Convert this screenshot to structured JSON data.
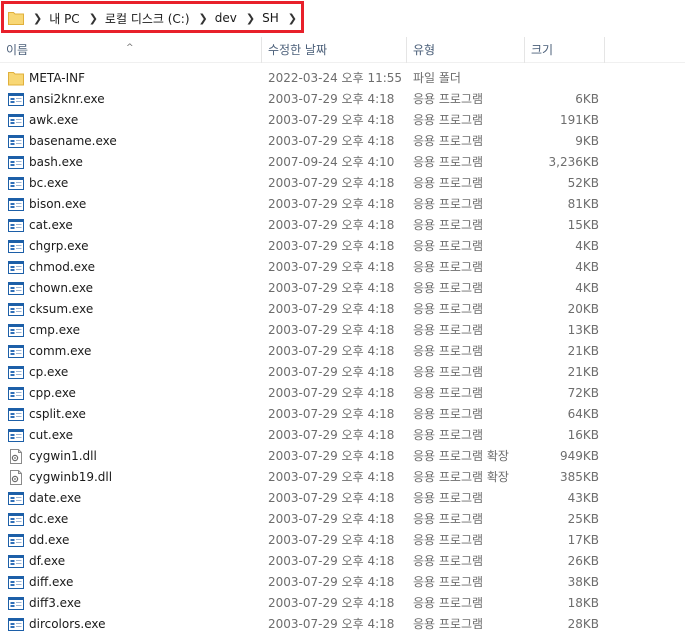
{
  "addressbar": {
    "folder_icon": "folder-icon",
    "sep_icon": "chevron-right-icon",
    "crumbs": [
      "내 PC",
      "로컬 디스크 (C:)",
      "dev",
      "SH"
    ],
    "highlight_color": "#e8202a"
  },
  "columns": {
    "name": "이름",
    "date": "수정한 날짜",
    "type": "유형",
    "size": "크기",
    "sort_indicator": "^"
  },
  "files": [
    {
      "icon": "folder-icon",
      "name": "META-INF",
      "date": "2022-03-24 오후 11:55",
      "type": "파일 폴더",
      "size": ""
    },
    {
      "icon": "exe-icon",
      "name": "ansi2knr.exe",
      "date": "2003-07-29 오후 4:18",
      "type": "응용 프로그램",
      "size": "6KB"
    },
    {
      "icon": "exe-icon",
      "name": "awk.exe",
      "date": "2003-07-29 오후 4:18",
      "type": "응용 프로그램",
      "size": "191KB"
    },
    {
      "icon": "exe-icon",
      "name": "basename.exe",
      "date": "2003-07-29 오후 4:18",
      "type": "응용 프로그램",
      "size": "9KB"
    },
    {
      "icon": "exe-icon",
      "name": "bash.exe",
      "date": "2007-09-24 오후 4:10",
      "type": "응용 프로그램",
      "size": "3,236KB"
    },
    {
      "icon": "exe-icon",
      "name": "bc.exe",
      "date": "2003-07-29 오후 4:18",
      "type": "응용 프로그램",
      "size": "52KB"
    },
    {
      "icon": "exe-icon",
      "name": "bison.exe",
      "date": "2003-07-29 오후 4:18",
      "type": "응용 프로그램",
      "size": "81KB"
    },
    {
      "icon": "exe-icon",
      "name": "cat.exe",
      "date": "2003-07-29 오후 4:18",
      "type": "응용 프로그램",
      "size": "15KB"
    },
    {
      "icon": "exe-icon",
      "name": "chgrp.exe",
      "date": "2003-07-29 오후 4:18",
      "type": "응용 프로그램",
      "size": "4KB"
    },
    {
      "icon": "exe-icon",
      "name": "chmod.exe",
      "date": "2003-07-29 오후 4:18",
      "type": "응용 프로그램",
      "size": "4KB"
    },
    {
      "icon": "exe-icon",
      "name": "chown.exe",
      "date": "2003-07-29 오후 4:18",
      "type": "응용 프로그램",
      "size": "4KB"
    },
    {
      "icon": "exe-icon",
      "name": "cksum.exe",
      "date": "2003-07-29 오후 4:18",
      "type": "응용 프로그램",
      "size": "20KB"
    },
    {
      "icon": "exe-icon",
      "name": "cmp.exe",
      "date": "2003-07-29 오후 4:18",
      "type": "응용 프로그램",
      "size": "13KB"
    },
    {
      "icon": "exe-icon",
      "name": "comm.exe",
      "date": "2003-07-29 오후 4:18",
      "type": "응용 프로그램",
      "size": "21KB"
    },
    {
      "icon": "exe-icon",
      "name": "cp.exe",
      "date": "2003-07-29 오후 4:18",
      "type": "응용 프로그램",
      "size": "21KB"
    },
    {
      "icon": "exe-icon",
      "name": "cpp.exe",
      "date": "2003-07-29 오후 4:18",
      "type": "응용 프로그램",
      "size": "72KB"
    },
    {
      "icon": "exe-icon",
      "name": "csplit.exe",
      "date": "2003-07-29 오후 4:18",
      "type": "응용 프로그램",
      "size": "64KB"
    },
    {
      "icon": "exe-icon",
      "name": "cut.exe",
      "date": "2003-07-29 오후 4:18",
      "type": "응용 프로그램",
      "size": "16KB"
    },
    {
      "icon": "dll-icon",
      "name": "cygwin1.dll",
      "date": "2003-07-29 오후 4:18",
      "type": "응용 프로그램 확장",
      "size": "949KB"
    },
    {
      "icon": "dll-icon",
      "name": "cygwinb19.dll",
      "date": "2003-07-29 오후 4:18",
      "type": "응용 프로그램 확장",
      "size": "385KB"
    },
    {
      "icon": "exe-icon",
      "name": "date.exe",
      "date": "2003-07-29 오후 4:18",
      "type": "응용 프로그램",
      "size": "43KB"
    },
    {
      "icon": "exe-icon",
      "name": "dc.exe",
      "date": "2003-07-29 오후 4:18",
      "type": "응용 프로그램",
      "size": "25KB"
    },
    {
      "icon": "exe-icon",
      "name": "dd.exe",
      "date": "2003-07-29 오후 4:18",
      "type": "응용 프로그램",
      "size": "17KB"
    },
    {
      "icon": "exe-icon",
      "name": "df.exe",
      "date": "2003-07-29 오후 4:18",
      "type": "응용 프로그램",
      "size": "26KB"
    },
    {
      "icon": "exe-icon",
      "name": "diff.exe",
      "date": "2003-07-29 오후 4:18",
      "type": "응용 프로그램",
      "size": "38KB"
    },
    {
      "icon": "exe-icon",
      "name": "diff3.exe",
      "date": "2003-07-29 오후 4:18",
      "type": "응용 프로그램",
      "size": "18KB"
    },
    {
      "icon": "exe-icon",
      "name": "dircolors.exe",
      "date": "2003-07-29 오후 4:18",
      "type": "응용 프로그램",
      "size": "28KB"
    }
  ]
}
